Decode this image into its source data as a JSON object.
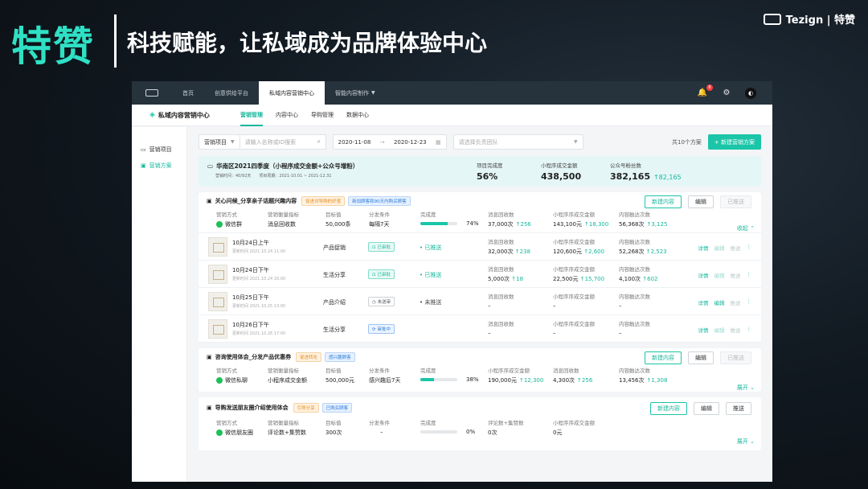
{
  "slide": {
    "big_title": "特赞",
    "subtitle": "科技赋能，让私域成为品牌体验中心",
    "brand": "Tezign | 特赞"
  },
  "topnav": {
    "items": [
      {
        "label": "首页"
      },
      {
        "label": "创意供给平台"
      },
      {
        "label": "私域内容营销中心"
      },
      {
        "label": "智能内容制作"
      }
    ],
    "notification_count": "8"
  },
  "subnav": {
    "title": "私域内容营销中心",
    "tabs": [
      {
        "label": "营销管理"
      },
      {
        "label": "内容中心"
      },
      {
        "label": "导购管理"
      },
      {
        "label": "数据中心"
      }
    ]
  },
  "sidebar": {
    "items": [
      {
        "label": "营销项目",
        "icon": "folder-icon"
      },
      {
        "label": "营销方案",
        "icon": "calendar-icon"
      }
    ]
  },
  "toolbar": {
    "select_label": "营销项目",
    "search_placeholder": "请输入名称或ID搜索",
    "date_start": "2020-11-08",
    "date_sep": "→",
    "date_end": "2020-12-23",
    "team_placeholder": "请选择负责团队",
    "count_text": "共10个方案",
    "new_plan_label": "+ 新建营销方案"
  },
  "summary": {
    "title": "华南区2021四季度（小程序成交金额+公众号增粉）",
    "meta_time": "营销时间：40/92天",
    "meta_cycle": "项目周期：2021-10.01 ~ 2021-12.31",
    "stats": [
      {
        "label": "项目完成度",
        "value": "56%",
        "delta": ""
      },
      {
        "label": "小程序成交金额",
        "value": "438,500",
        "delta": ""
      },
      {
        "label": "公众号粉丝数",
        "value": "382,165",
        "delta": "↑82,165"
      }
    ]
  },
  "labels": {
    "method": "营销方式",
    "indicator": "营销衡量指标",
    "target": "目标值",
    "condition": "分发条件",
    "completion": "完成度",
    "msg_recv": "消息回收数",
    "mini_amount": "小程序序成交金额",
    "content_reach": "内容触达次数",
    "comments_likes": "评论数+集赞数",
    "new_content": "新建内容",
    "edit": "编辑",
    "push": "推送",
    "pushed": "已推送",
    "collapse": "收起",
    "expand": "展开",
    "detail": "详情",
    "edit_small": "编辑",
    "push_small": "推送",
    "more": "⋮"
  },
  "cards": [
    {
      "title": "关心问候_分享亲子话题兴趣内容",
      "tags": [
        {
          "text": "促进对导购的好感",
          "color": "orange"
        },
        {
          "text": "新加顾客和90天内购买顾客",
          "color": "blue"
        }
      ],
      "method": "微信群",
      "indicator": "消息回收数",
      "target": "50,000条",
      "condition": "每隔7天",
      "completion": 74,
      "completion_text": "74%",
      "m1": {
        "value": "37,000次",
        "delta": "↑256"
      },
      "m2": {
        "value": "143,100元",
        "delta": "↑18,300"
      },
      "m3": {
        "value": "56,368次",
        "delta": "↑3,125"
      },
      "toggle": "收起",
      "sub_rows": [
        {
          "date": "10月24日上午",
          "updated": "更新时间 2021.10.24 11:00",
          "category": "产品促销",
          "review": "已审批",
          "review_type": "ok",
          "push": "已推送",
          "push_type": "ok",
          "c1": "32,000次",
          "d1": "↑238",
          "c2": "120,600元",
          "d2": "↑2,600",
          "c3": "52,268次",
          "d3": "↑2,523"
        },
        {
          "date": "10月24日下午",
          "updated": "更新时间 2021.10.24 16:00",
          "category": "生活分享",
          "review": "已审批",
          "review_type": "ok",
          "push": "已推送",
          "push_type": "ok",
          "c1": "5,000次",
          "d1": "↑18",
          "c2": "22,500元",
          "d2": "↑15,700",
          "c3": "4,100次",
          "d3": "↑602"
        },
        {
          "date": "10月25日下午",
          "updated": "更新时间 2021.10.25 13:00",
          "category": "产品介绍",
          "review": "未送审",
          "review_type": "no",
          "push": "未推送",
          "push_type": "no",
          "c1": "–",
          "d1": "",
          "c2": "–",
          "d2": "",
          "c3": "–",
          "d3": ""
        },
        {
          "date": "10月26日下午",
          "updated": "更新时间 2021.10.26 17:00",
          "category": "生活分享",
          "review": "审批中",
          "review_type": "ing",
          "push": "",
          "push_type": "no",
          "c1": "–",
          "d1": "",
          "c2": "–",
          "d2": "",
          "c3": "–",
          "d3": ""
        }
      ]
    },
    {
      "title": "咨询使用体会_分发产品优惠券",
      "tags": [
        {
          "text": "促进转化",
          "color": "orange"
        },
        {
          "text": "感兴趣顾客",
          "color": "blue"
        }
      ],
      "method": "微信私聊",
      "indicator": "小程序成交金额",
      "target": "500,000元",
      "condition": "感兴趣后7天",
      "completion": 38,
      "completion_text": "38%",
      "m1": {
        "value": "190,000元",
        "delta": "↑12,300"
      },
      "m2": {
        "value": "4,300次",
        "delta": "↑256"
      },
      "m3": {
        "value": "13,456次",
        "delta": "↑1,308"
      },
      "toggle": "展开"
    },
    {
      "title": "导购发送朋友圈介绍使用体会",
      "tags": [
        {
          "text": "引导分享",
          "color": "orange"
        },
        {
          "text": "已购买顾客",
          "color": "blue"
        }
      ],
      "method": "微信朋友圈",
      "indicator": "评论数+集赞数",
      "target": "300次",
      "condition": "–",
      "completion": 0,
      "completion_text": "0%",
      "m1": {
        "value": "0次",
        "delta": ""
      },
      "m2": {
        "value": "0元",
        "delta": ""
      },
      "toggle": "展开"
    }
  ]
}
